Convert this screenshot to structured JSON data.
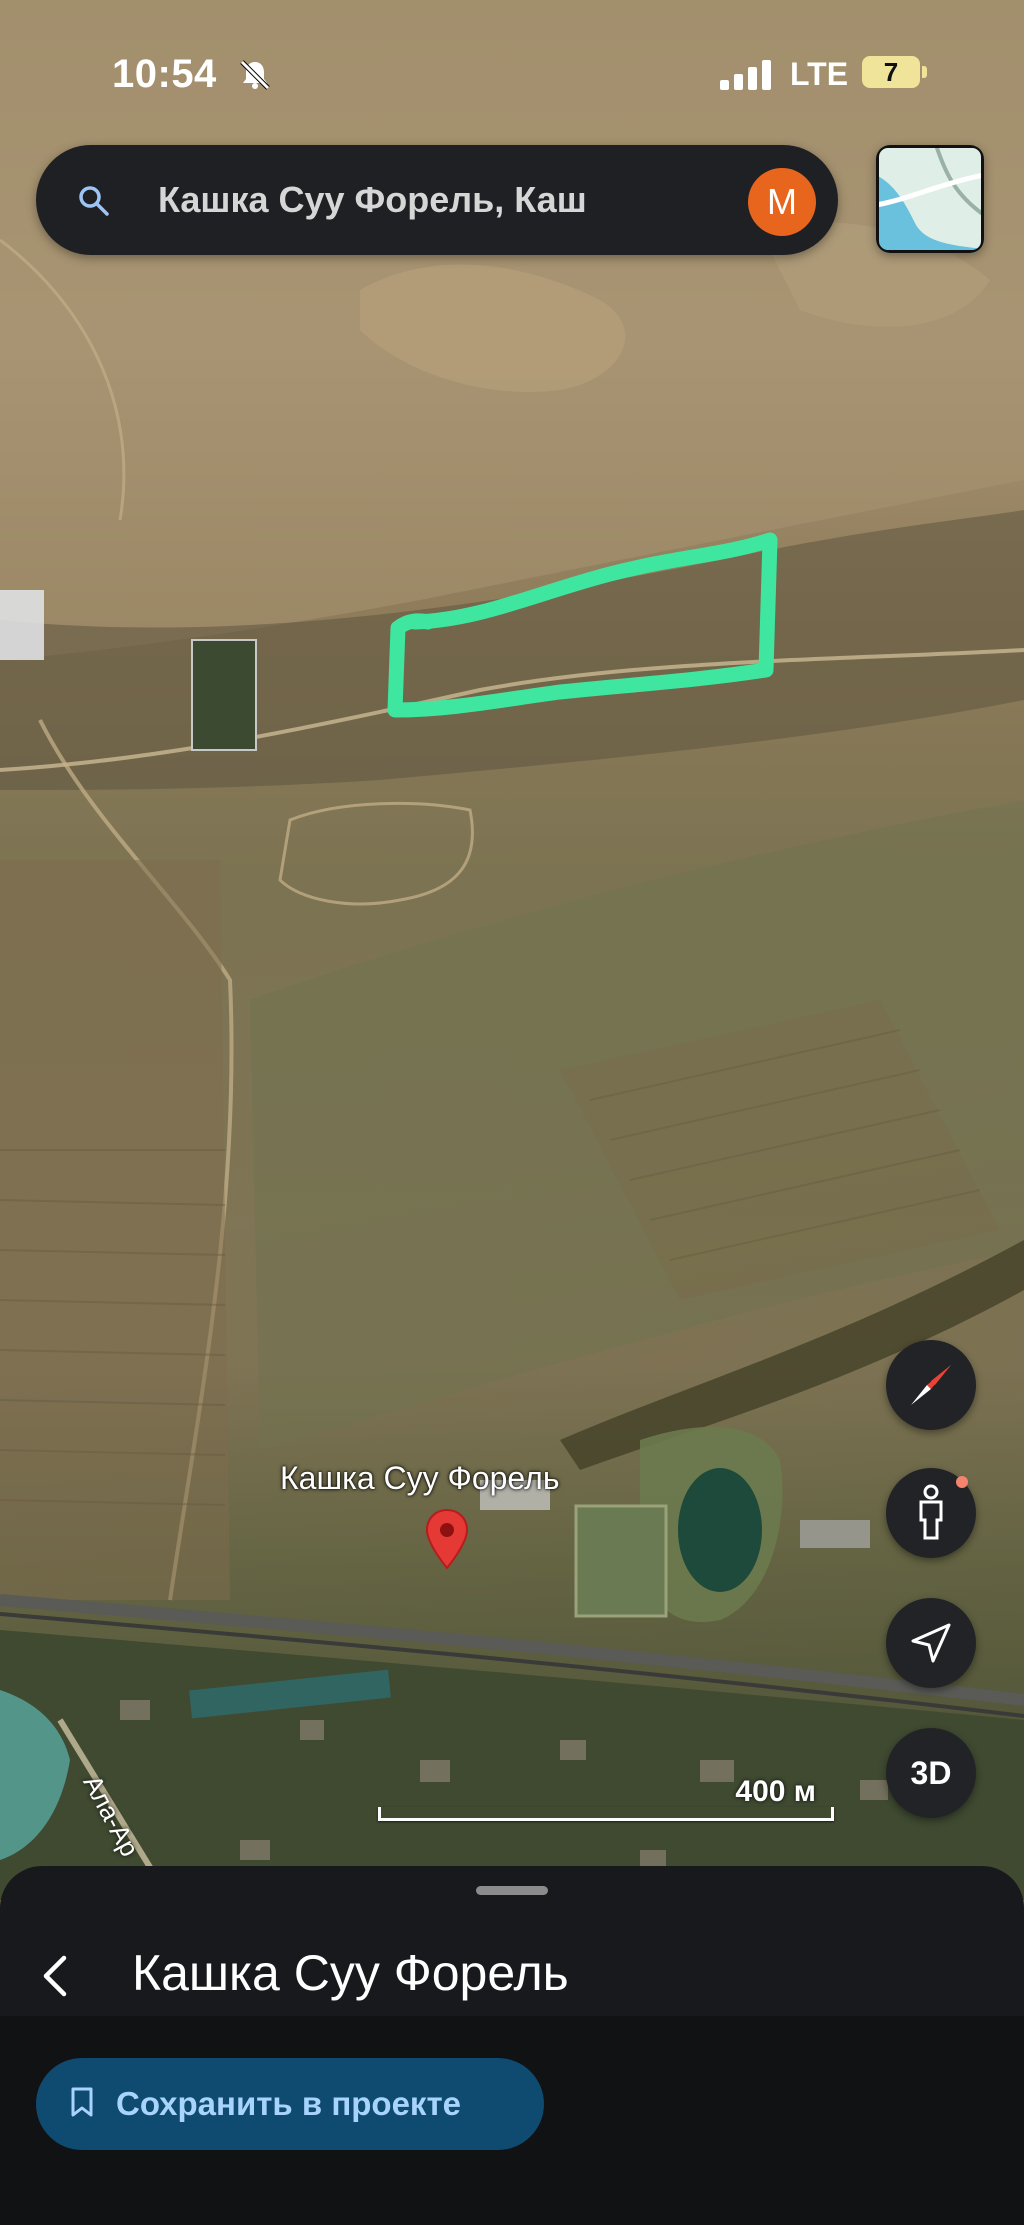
{
  "status_bar": {
    "time": "10:54",
    "network": "LTE",
    "battery": "7"
  },
  "search": {
    "query": "Кашка Суу Форель, Каш",
    "avatar_letter": "M"
  },
  "map": {
    "place_label": "Кашка Суу Форель",
    "road_label": "Ала-Ар",
    "scale_label": "400 м",
    "highlight_color": "#3fe6a0",
    "pin_color": "#e53935"
  },
  "controls": {
    "three_d_label": "3D"
  },
  "sheet": {
    "title": "Кашка Суу Форель",
    "save_label": "Сохранить в проекте"
  }
}
